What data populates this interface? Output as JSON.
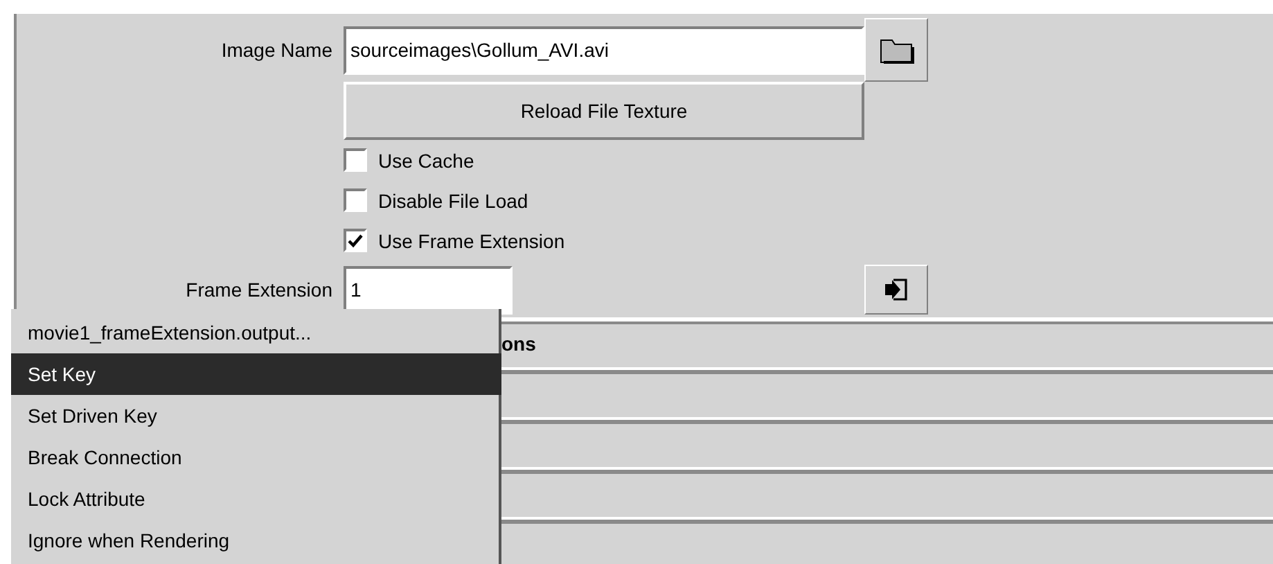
{
  "image_name": {
    "label": "Image Name",
    "value": "sourceimages\\Gollum_AVI.avi"
  },
  "reload_button": {
    "label": "Reload File Texture"
  },
  "checkboxes": [
    {
      "label": "Use Cache",
      "checked": false
    },
    {
      "label": "Disable File Load",
      "checked": false
    },
    {
      "label": "Use Frame Extension",
      "checked": true
    }
  ],
  "frame_extension": {
    "label": "Frame Extension",
    "value": "1"
  },
  "sections": [
    {
      "title": "ons"
    }
  ],
  "context_menu": [
    {
      "label": "movie1_frameExtension.output...",
      "selected": false
    },
    {
      "label": "Set Key",
      "selected": true
    },
    {
      "label": "Set Driven Key",
      "selected": false
    },
    {
      "label": "Break Connection",
      "selected": false
    },
    {
      "label": "Lock Attribute",
      "selected": false
    },
    {
      "label": "Ignore when Rendering",
      "selected": false
    }
  ]
}
